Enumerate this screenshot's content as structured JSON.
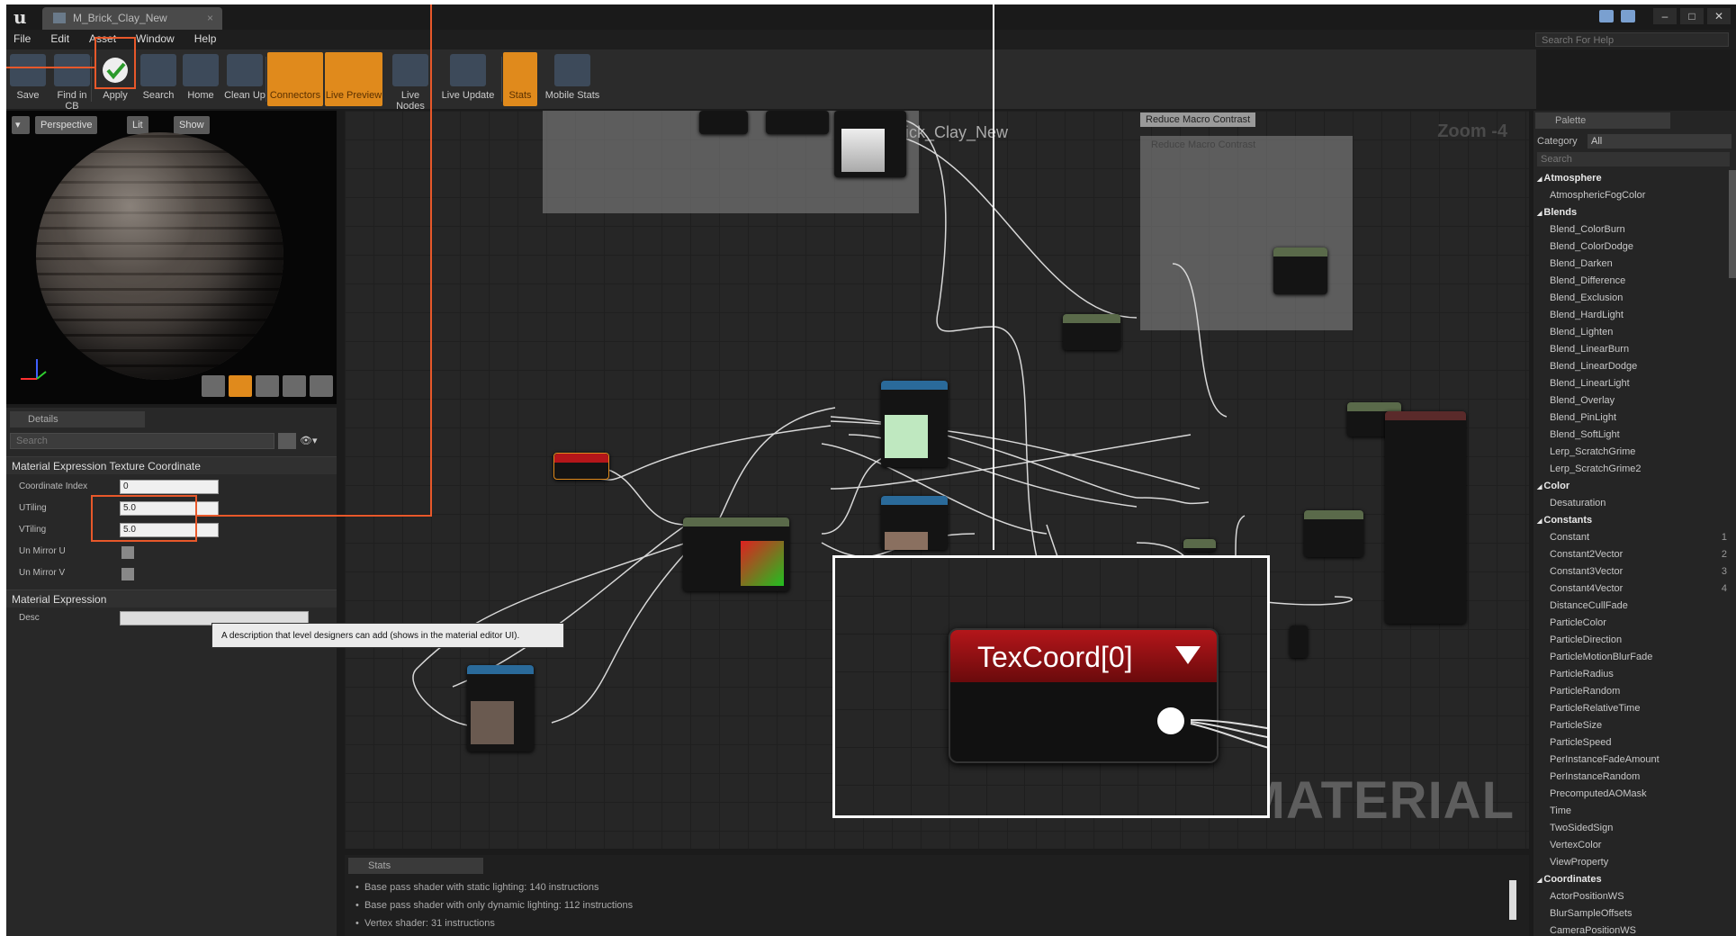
{
  "window": {
    "tab_title": "M_Brick_Clay_New",
    "help_search_placeholder": "Search For Help"
  },
  "menu": [
    "File",
    "Edit",
    "Asset",
    "Window",
    "Help"
  ],
  "toolbar": [
    {
      "label": "Save",
      "icon": "save-icon",
      "active": false
    },
    {
      "label": "Find in CB",
      "icon": "find-in-cb-icon",
      "active": false
    },
    {
      "label": "Apply",
      "icon": "apply-checkmark-icon",
      "active": false
    },
    {
      "label": "Search",
      "icon": "search-icon",
      "active": false
    },
    {
      "label": "Home",
      "icon": "home-icon",
      "active": false
    },
    {
      "label": "Clean Up",
      "icon": "clean-up-icon",
      "active": false
    },
    {
      "label": "Connectors",
      "icon": "connectors-icon",
      "active": true
    },
    {
      "label": "Live Preview",
      "icon": "live-preview-icon",
      "active": true
    },
    {
      "label": "Live Nodes",
      "icon": "live-nodes-icon",
      "active": false
    },
    {
      "label": "Live Update",
      "icon": "live-update-icon",
      "active": false
    },
    {
      "label": "Stats",
      "icon": "stats-icon",
      "active": true
    },
    {
      "label": "Mobile Stats",
      "icon": "mobile-stats-icon",
      "active": false
    }
  ],
  "viewport": {
    "buttons": [
      "Perspective",
      "Lit",
      "Show"
    ]
  },
  "details": {
    "tab": "Details",
    "search_placeholder": "Search",
    "section1": "Material Expression Texture Coordinate",
    "props": [
      {
        "label": "Coordinate Index",
        "value": "0"
      },
      {
        "label": "UTiling",
        "value": "5.0"
      },
      {
        "label": "VTiling",
        "value": "5.0"
      },
      {
        "label": "Un Mirror U",
        "value": ""
      },
      {
        "label": "Un Mirror V",
        "value": ""
      }
    ],
    "section2": "Material Expression",
    "desc_label": "Desc",
    "tooltip": "A description that level designers can add (shows in the material editor UI)."
  },
  "graph": {
    "title": "M_Brick_Clay_New",
    "zoom": "Zoom -4",
    "watermark": "MATERIAL",
    "comment_title": "Reduce Macro Contrast",
    "comment_subtitle": "Reduce Macro Contrast",
    "zoom_node_title": "TexCoord[0]"
  },
  "stats": {
    "tab": "Stats",
    "lines": [
      "Base pass shader with static lighting: 140 instructions",
      "Base pass shader with only dynamic lighting: 112 instructions",
      "Vertex shader: 31 instructions"
    ]
  },
  "palette": {
    "tab": "Palette",
    "category_label": "Category",
    "category_value": "All",
    "search_placeholder": "Search",
    "items": [
      {
        "t": "Atmosphere",
        "cat": true
      },
      {
        "t": "AtmosphericFogColor"
      },
      {
        "t": "Blends",
        "cat": true
      },
      {
        "t": "Blend_ColorBurn"
      },
      {
        "t": "Blend_ColorDodge"
      },
      {
        "t": "Blend_Darken"
      },
      {
        "t": "Blend_Difference"
      },
      {
        "t": "Blend_Exclusion"
      },
      {
        "t": "Blend_HardLight"
      },
      {
        "t": "Blend_Lighten"
      },
      {
        "t": "Blend_LinearBurn"
      },
      {
        "t": "Blend_LinearDodge"
      },
      {
        "t": "Blend_LinearLight"
      },
      {
        "t": "Blend_Overlay"
      },
      {
        "t": "Blend_PinLight"
      },
      {
        "t": "Blend_SoftLight"
      },
      {
        "t": "Lerp_ScratchGrime"
      },
      {
        "t": "Lerp_ScratchGrime2"
      },
      {
        "t": "Color",
        "cat": true
      },
      {
        "t": "Desaturation"
      },
      {
        "t": "Constants",
        "cat": true
      },
      {
        "t": "Constant",
        "k": "1"
      },
      {
        "t": "Constant2Vector",
        "k": "2"
      },
      {
        "t": "Constant3Vector",
        "k": "3"
      },
      {
        "t": "Constant4Vector",
        "k": "4"
      },
      {
        "t": "DistanceCullFade"
      },
      {
        "t": "ParticleColor"
      },
      {
        "t": "ParticleDirection"
      },
      {
        "t": "ParticleMotionBlurFade"
      },
      {
        "t": "ParticleRadius"
      },
      {
        "t": "ParticleRandom"
      },
      {
        "t": "ParticleRelativeTime"
      },
      {
        "t": "ParticleSize"
      },
      {
        "t": "ParticleSpeed"
      },
      {
        "t": "PerInstanceFadeAmount"
      },
      {
        "t": "PerInstanceRandom"
      },
      {
        "t": "PrecomputedAOMask"
      },
      {
        "t": "Time"
      },
      {
        "t": "TwoSidedSign"
      },
      {
        "t": "VertexColor"
      },
      {
        "t": "ViewProperty"
      },
      {
        "t": "Coordinates",
        "cat": true
      },
      {
        "t": "ActorPositionWS"
      },
      {
        "t": "BlurSampleOffsets"
      },
      {
        "t": "CameraPositionWS"
      }
    ]
  },
  "colors": {
    "accent": "#e08a1c",
    "highlight": "#e8582a",
    "node_header_red": "#b4161a"
  }
}
